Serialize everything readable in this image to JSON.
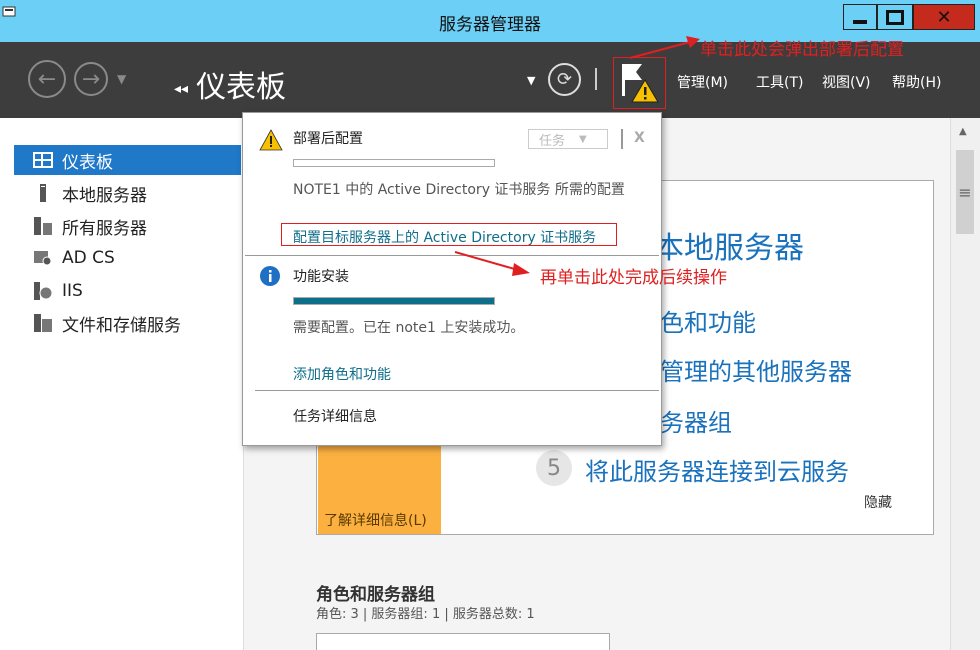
{
  "window": {
    "title": "服务器管理器"
  },
  "toolbar": {
    "breadcrumb": "仪表板",
    "menus": [
      "管理(M)",
      "工具(T)",
      "视图(V)",
      "帮助(H)"
    ]
  },
  "sidebar": {
    "items": [
      {
        "label": "仪表板",
        "icon": "dashboard-icon",
        "selected": true
      },
      {
        "label": "本地服务器",
        "icon": "server-icon"
      },
      {
        "label": "所有服务器",
        "icon": "servers-icon"
      },
      {
        "label": "AD CS",
        "icon": "certificate-icon"
      },
      {
        "label": "IIS",
        "icon": "iis-icon"
      },
      {
        "label": "文件和存储服务",
        "icon": "file-storage-icon"
      }
    ]
  },
  "content": {
    "step1": "本地服务器",
    "step2": "色和功能",
    "step3": "管理的其他服务器",
    "step4": "务器组",
    "step5_num": "5",
    "step5": "将此服务器连接到云服务",
    "learn_more": "了解详细信息(L)",
    "hide": "隐藏",
    "roles_title": "角色和服务器组",
    "roles_summary": "角色: 3 | 服务器组: 1 | 服务器总数: 1"
  },
  "popup": {
    "task_button": "任务",
    "close_label": "X",
    "notif1": {
      "title": "部署后配置",
      "desc": "NOTE1 中的 Active Directory 证书服务 所需的配置",
      "link": "配置目标服务器上的 Active Directory 证书服务",
      "progress": 0
    },
    "notif2": {
      "title": "功能安装",
      "desc": "需要配置。已在 note1 上安装成功。",
      "link": "添加角色和功能",
      "progress": 1.0
    },
    "task_details": "任务详细信息"
  },
  "annotations": {
    "flag_note": "单击此处会弹出部署后配置",
    "link_note": "再单击此处完成后续操作"
  },
  "colors": {
    "titlebar": "#6ccff6",
    "toolbar": "#3d3d3d",
    "selected": "#1f78c8",
    "link": "#1a72bd",
    "orange": "#fbb040",
    "annotation": "#e02020",
    "progress": "#0e6f8a"
  }
}
